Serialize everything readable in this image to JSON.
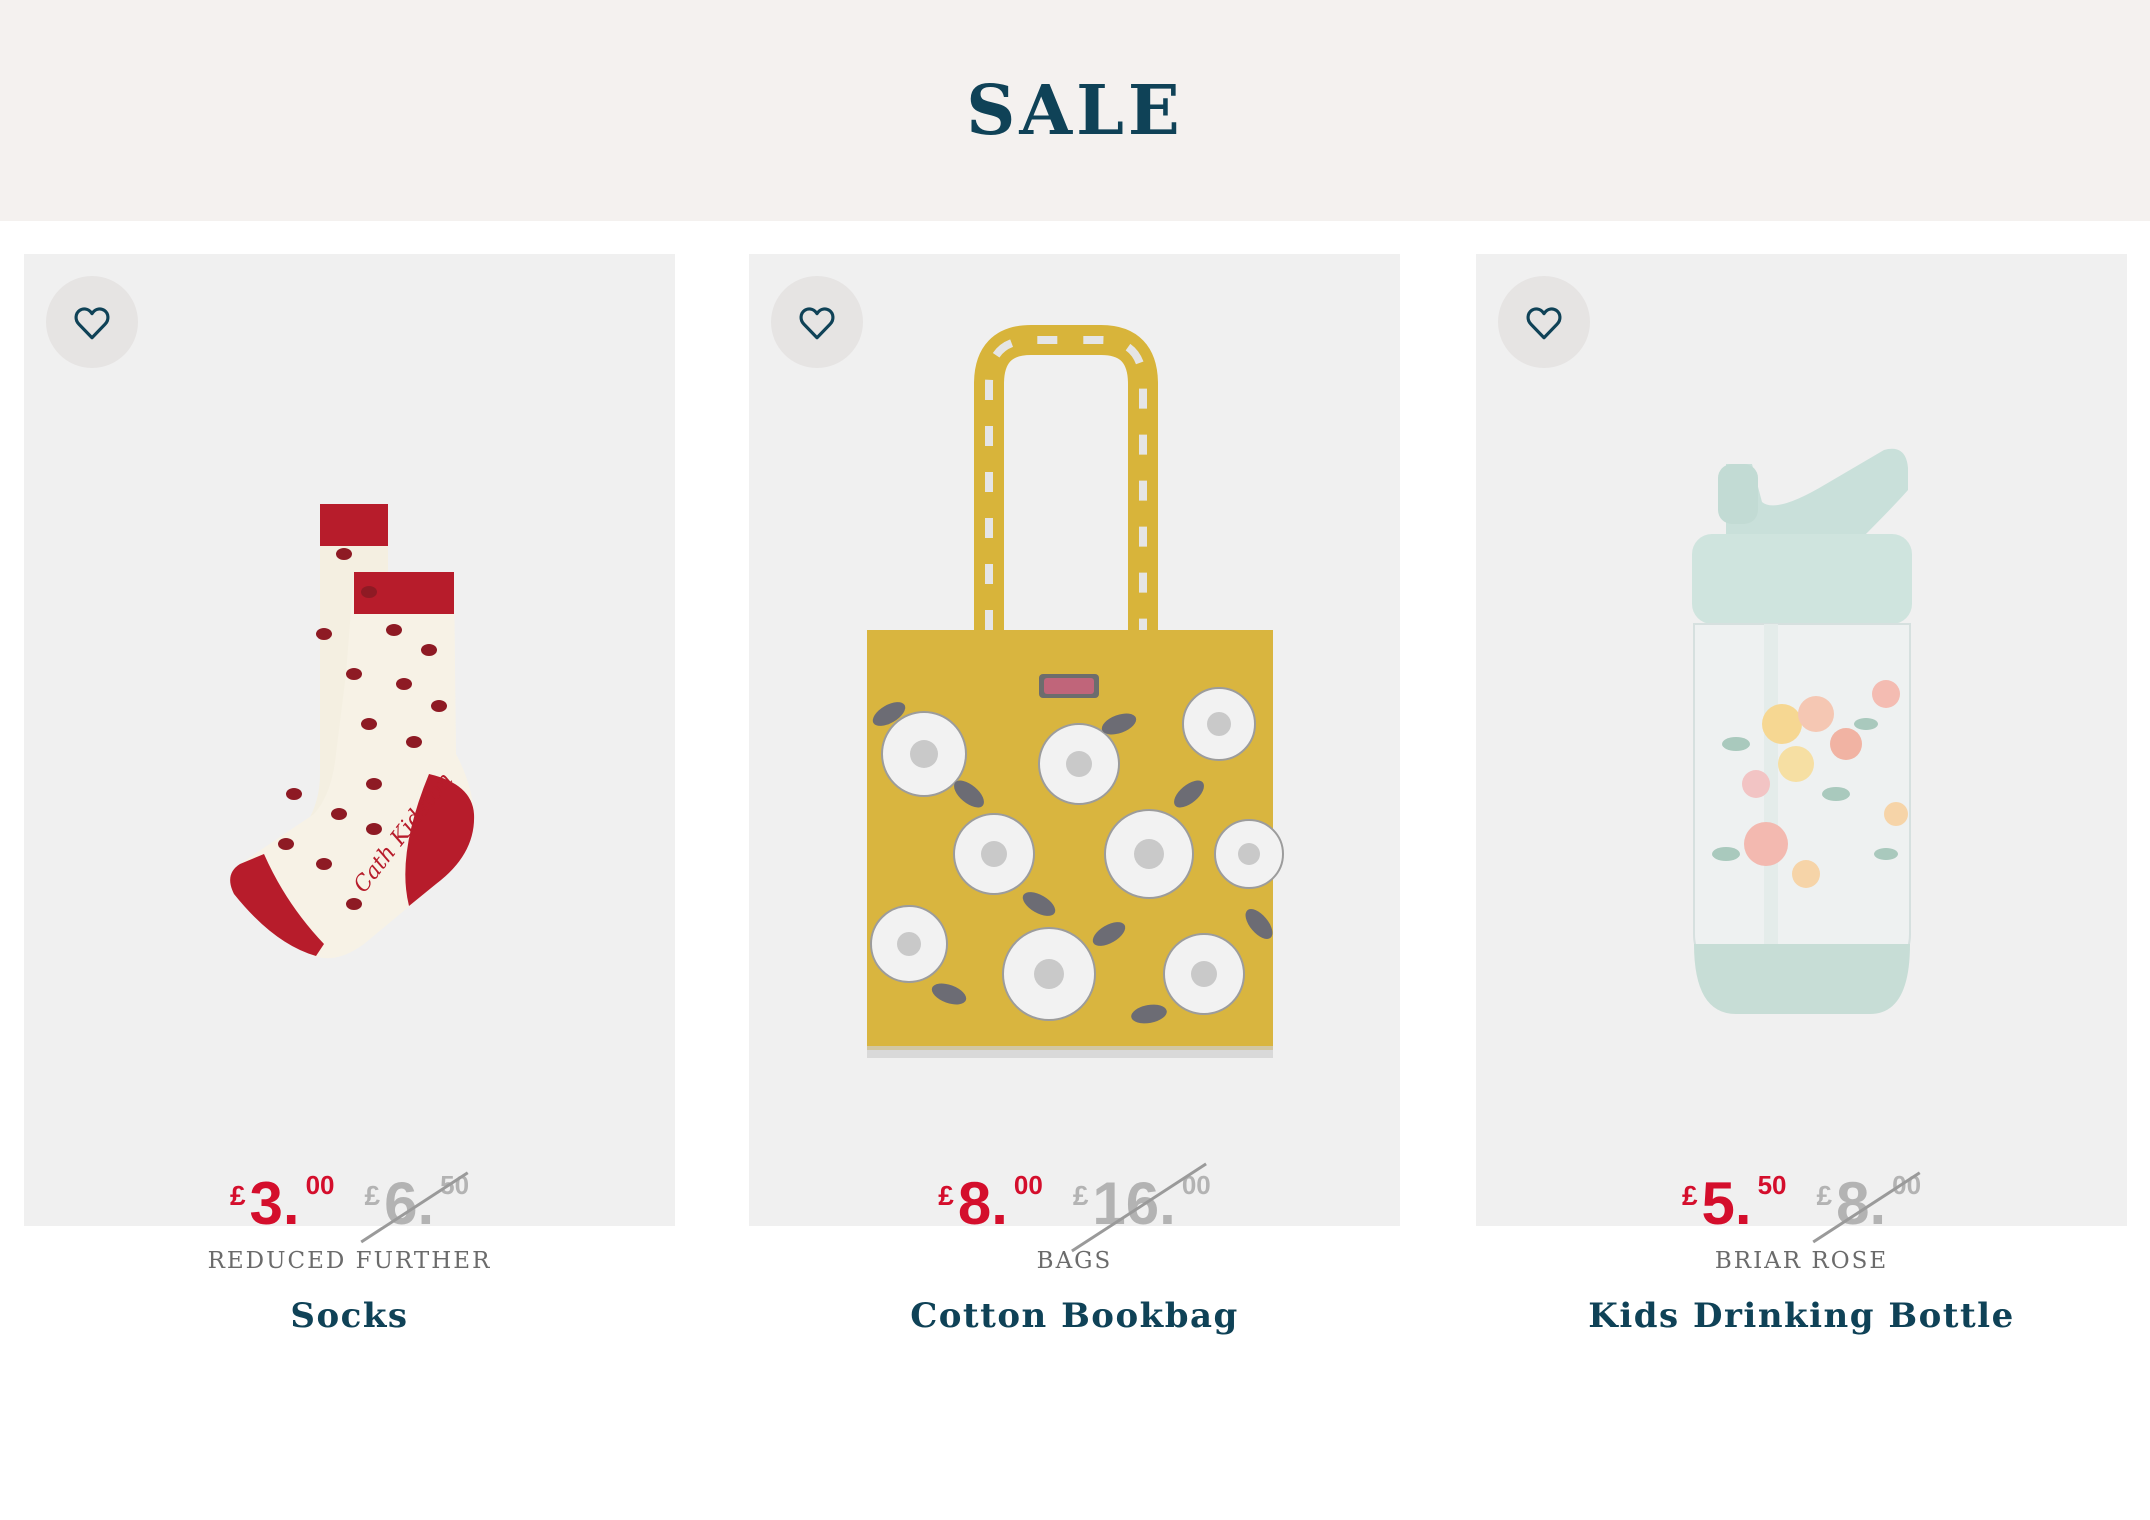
{
  "banner": {
    "title": "SALE"
  },
  "products": [
    {
      "category": "REDUCED FURTHER",
      "title": "Socks",
      "image_alt": "socks-image",
      "price_now": {
        "currency": "£",
        "main": "3.",
        "decimals": "00"
      },
      "price_was": {
        "currency": "£",
        "main": "6.",
        "decimals": "50"
      }
    },
    {
      "category": "BAGS",
      "title": "Cotton Bookbag",
      "image_alt": "bookbag-image",
      "price_now": {
        "currency": "£",
        "main": "8.",
        "decimals": "00"
      },
      "price_was": {
        "currency": "£",
        "main": "16.",
        "decimals": "00"
      }
    },
    {
      "category": "BRIAR ROSE",
      "title": "Kids Drinking Bottle",
      "image_alt": "bottle-image",
      "price_now": {
        "currency": "£",
        "main": "5.",
        "decimals": "50"
      },
      "price_was": {
        "currency": "£",
        "main": "8.",
        "decimals": "00"
      }
    }
  ],
  "colors": {
    "sale_price": "#d40e2c",
    "was_price": "#b3b3b3",
    "title": "#0f4257",
    "banner_bg": "#f4f1ef",
    "image_bg": "#f0f0f0"
  },
  "icons": {
    "wishlist": "heart-outline-icon"
  }
}
